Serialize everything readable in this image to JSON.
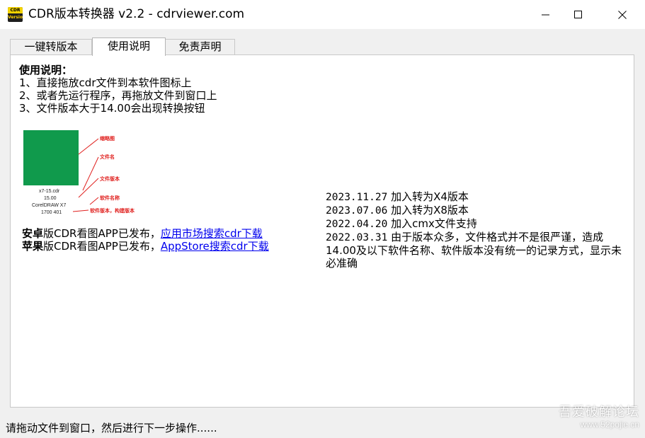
{
  "window": {
    "title": "CDR版本转换器 v2.2 - cdrviewer.com",
    "icon_top": "CDR",
    "icon_bottom": "Version"
  },
  "tabs": [
    {
      "label": "一键转版本",
      "active": false
    },
    {
      "label": "使用说明",
      "active": true
    },
    {
      "label": "免责声明",
      "active": false
    }
  ],
  "usage": {
    "heading": "使用说明：",
    "lines": [
      "1、直接拖放cdr文件到本软件图标上",
      "2、或者先运行程序，再拖放文件到窗口上",
      "3、文件版本大于14.00会出现转换按钮"
    ]
  },
  "diagram": {
    "thumb_color": "#109a4c",
    "accent_color": "#e0201e",
    "thumb_lines": [
      "x7-15.cdr",
      "15.00",
      "CorelDRAW X7",
      "1700 401"
    ],
    "labels": [
      "缩略图",
      "文件名",
      "文件版本",
      "软件名称",
      "软件版本，构建版本"
    ]
  },
  "apps": {
    "android_bold": "安卓",
    "android_text": "版CDR看图APP已发布，",
    "android_link": "应用市场搜索cdr下载",
    "ios_bold": "苹果",
    "ios_text": "版CDR看图APP已发布，",
    "ios_link": "AppStore搜索cdr下载"
  },
  "changelog": [
    {
      "date": "2023.11.27",
      "text": " 加入转为X4版本"
    },
    {
      "date": "2023.07.06",
      "text": " 加入转为X8版本"
    },
    {
      "date": "2022.04.20",
      "text": " 加入cmx文件支持"
    },
    {
      "date": "2022.03.31",
      "text": " 由于版本众多，文件格式并不是很严谨，造成14.00及以下软件名称、软件版本没有统一的记录方式，显示未必准确"
    }
  ],
  "status": {
    "text": "请拖动文件到窗口，然后进行下一步操作......"
  },
  "watermark": {
    "line1": "吾爱破解论坛",
    "line2": "www.52pojie.cn"
  }
}
